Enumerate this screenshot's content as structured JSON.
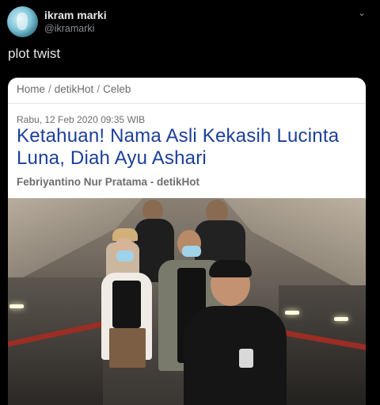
{
  "tweet": {
    "display_name": "ikram marki",
    "handle": "@ikramarki",
    "text": "plot twist"
  },
  "card": {
    "breadcrumb": [
      "Home",
      "detikHot",
      "Celeb"
    ],
    "breadcrumb_separator": "/",
    "date": "Rabu, 12 Feb 2020 09:35 WIB",
    "headline": "Ketahuan! Nama Asli Kekasih Lucinta Luna, Diah Ayu Ashari",
    "byline": "Febriyantino Nur Pratama - detikHot"
  },
  "colors": {
    "background": "#000000",
    "headline": "#1c3f9a",
    "card": "#ffffff"
  },
  "icons": {
    "menu": "chevron-down-icon"
  }
}
